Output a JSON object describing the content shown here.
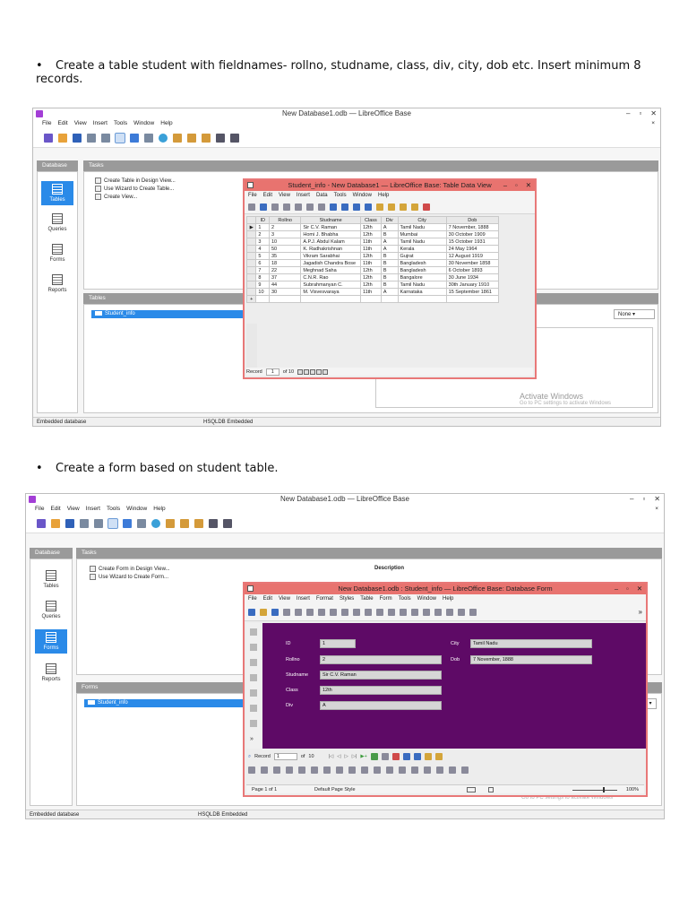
{
  "bullet1": {
    "symbol": "•",
    "text": "Create a table student with fieldnames- rollno, studname, class, div, city, dob etc.  Insert minimum 8 records."
  },
  "bullet2": {
    "symbol": "•",
    "text": "Create a form based on student table."
  },
  "main_window": {
    "title": "New Database1.odb — LibreOffice Base",
    "controls": [
      "–",
      "▫",
      "✕"
    ],
    "menu": [
      "File",
      "Edit",
      "View",
      "Insert",
      "Tools",
      "Window",
      "Help"
    ],
    "menu_close": "×",
    "database_header": "Database",
    "tasks_header": "Tasks",
    "nav_items": [
      "Tables",
      "Queries",
      "Forms",
      "Reports"
    ],
    "description_label": "Description",
    "status_left": "Embedded database",
    "status_right": "HSQLDB Embedded",
    "watermark_title": "Activate Windows",
    "watermark_sub": "Go to PC settings to activate Windows"
  },
  "screen1": {
    "tasks": [
      "Create Table in Design View...",
      "Use Wizard to Create Table...",
      "Create View..."
    ],
    "tables_header": "Tables",
    "table_item": "Student_info",
    "none_select": "None",
    "dialog": {
      "title": "Student_info - New Database1 — LibreOffice Base: Table Data View",
      "controls": [
        "–",
        "▫",
        "✕"
      ],
      "menu": [
        "File",
        "Edit",
        "View",
        "Insert",
        "Data",
        "Tools",
        "Window",
        "Help"
      ],
      "columns": [
        "ID",
        "Rollno",
        "Studname",
        "Class",
        "Div",
        "City",
        "Dob"
      ],
      "rows": [
        [
          "▶",
          "1",
          "2",
          "Sir C.V. Raman",
          "12th",
          "A",
          "Tamil Nadu",
          "7 November, 1888"
        ],
        [
          "",
          "2",
          "3",
          "Homi J. Bhabha",
          "12th",
          "B",
          "Mumbai",
          "30 October 1909"
        ],
        [
          "",
          "3",
          "10",
          "A.P.J. Abdul Kalam",
          "11th",
          "A",
          "Tamil Nadu",
          "15 October 1931"
        ],
        [
          "",
          "4",
          "50",
          "K. Radhakrishnan",
          "11th",
          "A",
          "Kerala",
          "24 May 1964"
        ],
        [
          "",
          "5",
          "35",
          "Vikram Sarabhai",
          "12th",
          "B",
          "Gujrat",
          "12 August 1919"
        ],
        [
          "",
          "6",
          "18",
          "Jagadish Chandra Bose",
          "11th",
          "B",
          "Bangladesh",
          "30 November 1858"
        ],
        [
          "",
          "7",
          "22",
          "Meghnad Saha",
          "12th",
          "B",
          "Bangladesh",
          "6 October 1893"
        ],
        [
          "",
          "8",
          "37",
          "C.N.R. Rao",
          "12th",
          "B",
          "Bangalore",
          "30 June 1934"
        ],
        [
          "",
          "9",
          "44",
          "Subrahmanyan C.",
          "12th",
          "B",
          "Tamil Nadu",
          "30th January 1910"
        ],
        [
          "",
          "10",
          "30",
          "M. Visvesvaraya",
          "11th",
          "A",
          "Karnataka",
          "15 September 1861"
        ],
        [
          "+",
          "",
          "",
          "",
          "",
          "",
          "",
          ""
        ]
      ],
      "record_label": "Record",
      "record_value": "1",
      "record_of": "of 10"
    }
  },
  "screen2": {
    "tasks": [
      "Create Form in Design View...",
      "Use Wizard to Create Form..."
    ],
    "forms_header": "Forms",
    "form_item": "Student_info",
    "dialog": {
      "title": "New Database1.odb : Student_info — LibreOffice Base: Database Form",
      "controls": [
        "–",
        "▫",
        "✕"
      ],
      "menu": [
        "File",
        "Edit",
        "View",
        "Insert",
        "Format",
        "Styles",
        "Table",
        "Form",
        "Tools",
        "Window",
        "Help"
      ],
      "overflow": "»",
      "fields_left": [
        {
          "label": "ID",
          "value": "1"
        },
        {
          "label": "Rollno",
          "value": "2"
        },
        {
          "label": "Studname",
          "value": "Sir C.V. Raman"
        },
        {
          "label": "Class",
          "value": "12th"
        },
        {
          "label": "Div",
          "value": "A"
        }
      ],
      "fields_right": [
        {
          "label": "City",
          "value": "Tamil Nadu"
        },
        {
          "label": "Dob",
          "value": "7 November, 1888"
        }
      ],
      "record_label": "Record",
      "record_value": "1",
      "record_of": "of",
      "record_total": "10",
      "status_page": "Page 1 of 1",
      "status_style": "Default Page Style",
      "zoom": "100%"
    }
  }
}
